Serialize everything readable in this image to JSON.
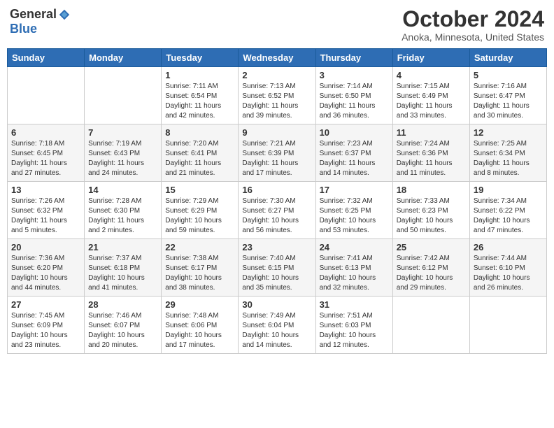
{
  "header": {
    "logo_general": "General",
    "logo_blue": "Blue",
    "month_title": "October 2024",
    "location": "Anoka, Minnesota, United States"
  },
  "days_of_week": [
    "Sunday",
    "Monday",
    "Tuesday",
    "Wednesday",
    "Thursday",
    "Friday",
    "Saturday"
  ],
  "weeks": [
    [
      {
        "day": "",
        "info": ""
      },
      {
        "day": "",
        "info": ""
      },
      {
        "day": "1",
        "info": "Sunrise: 7:11 AM\nSunset: 6:54 PM\nDaylight: 11 hours and 42 minutes."
      },
      {
        "day": "2",
        "info": "Sunrise: 7:13 AM\nSunset: 6:52 PM\nDaylight: 11 hours and 39 minutes."
      },
      {
        "day": "3",
        "info": "Sunrise: 7:14 AM\nSunset: 6:50 PM\nDaylight: 11 hours and 36 minutes."
      },
      {
        "day": "4",
        "info": "Sunrise: 7:15 AM\nSunset: 6:49 PM\nDaylight: 11 hours and 33 minutes."
      },
      {
        "day": "5",
        "info": "Sunrise: 7:16 AM\nSunset: 6:47 PM\nDaylight: 11 hours and 30 minutes."
      }
    ],
    [
      {
        "day": "6",
        "info": "Sunrise: 7:18 AM\nSunset: 6:45 PM\nDaylight: 11 hours and 27 minutes."
      },
      {
        "day": "7",
        "info": "Sunrise: 7:19 AM\nSunset: 6:43 PM\nDaylight: 11 hours and 24 minutes."
      },
      {
        "day": "8",
        "info": "Sunrise: 7:20 AM\nSunset: 6:41 PM\nDaylight: 11 hours and 21 minutes."
      },
      {
        "day": "9",
        "info": "Sunrise: 7:21 AM\nSunset: 6:39 PM\nDaylight: 11 hours and 17 minutes."
      },
      {
        "day": "10",
        "info": "Sunrise: 7:23 AM\nSunset: 6:37 PM\nDaylight: 11 hours and 14 minutes."
      },
      {
        "day": "11",
        "info": "Sunrise: 7:24 AM\nSunset: 6:36 PM\nDaylight: 11 hours and 11 minutes."
      },
      {
        "day": "12",
        "info": "Sunrise: 7:25 AM\nSunset: 6:34 PM\nDaylight: 11 hours and 8 minutes."
      }
    ],
    [
      {
        "day": "13",
        "info": "Sunrise: 7:26 AM\nSunset: 6:32 PM\nDaylight: 11 hours and 5 minutes."
      },
      {
        "day": "14",
        "info": "Sunrise: 7:28 AM\nSunset: 6:30 PM\nDaylight: 11 hours and 2 minutes."
      },
      {
        "day": "15",
        "info": "Sunrise: 7:29 AM\nSunset: 6:29 PM\nDaylight: 10 hours and 59 minutes."
      },
      {
        "day": "16",
        "info": "Sunrise: 7:30 AM\nSunset: 6:27 PM\nDaylight: 10 hours and 56 minutes."
      },
      {
        "day": "17",
        "info": "Sunrise: 7:32 AM\nSunset: 6:25 PM\nDaylight: 10 hours and 53 minutes."
      },
      {
        "day": "18",
        "info": "Sunrise: 7:33 AM\nSunset: 6:23 PM\nDaylight: 10 hours and 50 minutes."
      },
      {
        "day": "19",
        "info": "Sunrise: 7:34 AM\nSunset: 6:22 PM\nDaylight: 10 hours and 47 minutes."
      }
    ],
    [
      {
        "day": "20",
        "info": "Sunrise: 7:36 AM\nSunset: 6:20 PM\nDaylight: 10 hours and 44 minutes."
      },
      {
        "day": "21",
        "info": "Sunrise: 7:37 AM\nSunset: 6:18 PM\nDaylight: 10 hours and 41 minutes."
      },
      {
        "day": "22",
        "info": "Sunrise: 7:38 AM\nSunset: 6:17 PM\nDaylight: 10 hours and 38 minutes."
      },
      {
        "day": "23",
        "info": "Sunrise: 7:40 AM\nSunset: 6:15 PM\nDaylight: 10 hours and 35 minutes."
      },
      {
        "day": "24",
        "info": "Sunrise: 7:41 AM\nSunset: 6:13 PM\nDaylight: 10 hours and 32 minutes."
      },
      {
        "day": "25",
        "info": "Sunrise: 7:42 AM\nSunset: 6:12 PM\nDaylight: 10 hours and 29 minutes."
      },
      {
        "day": "26",
        "info": "Sunrise: 7:44 AM\nSunset: 6:10 PM\nDaylight: 10 hours and 26 minutes."
      }
    ],
    [
      {
        "day": "27",
        "info": "Sunrise: 7:45 AM\nSunset: 6:09 PM\nDaylight: 10 hours and 23 minutes."
      },
      {
        "day": "28",
        "info": "Sunrise: 7:46 AM\nSunset: 6:07 PM\nDaylight: 10 hours and 20 minutes."
      },
      {
        "day": "29",
        "info": "Sunrise: 7:48 AM\nSunset: 6:06 PM\nDaylight: 10 hours and 17 minutes."
      },
      {
        "day": "30",
        "info": "Sunrise: 7:49 AM\nSunset: 6:04 PM\nDaylight: 10 hours and 14 minutes."
      },
      {
        "day": "31",
        "info": "Sunrise: 7:51 AM\nSunset: 6:03 PM\nDaylight: 10 hours and 12 minutes."
      },
      {
        "day": "",
        "info": ""
      },
      {
        "day": "",
        "info": ""
      }
    ]
  ]
}
